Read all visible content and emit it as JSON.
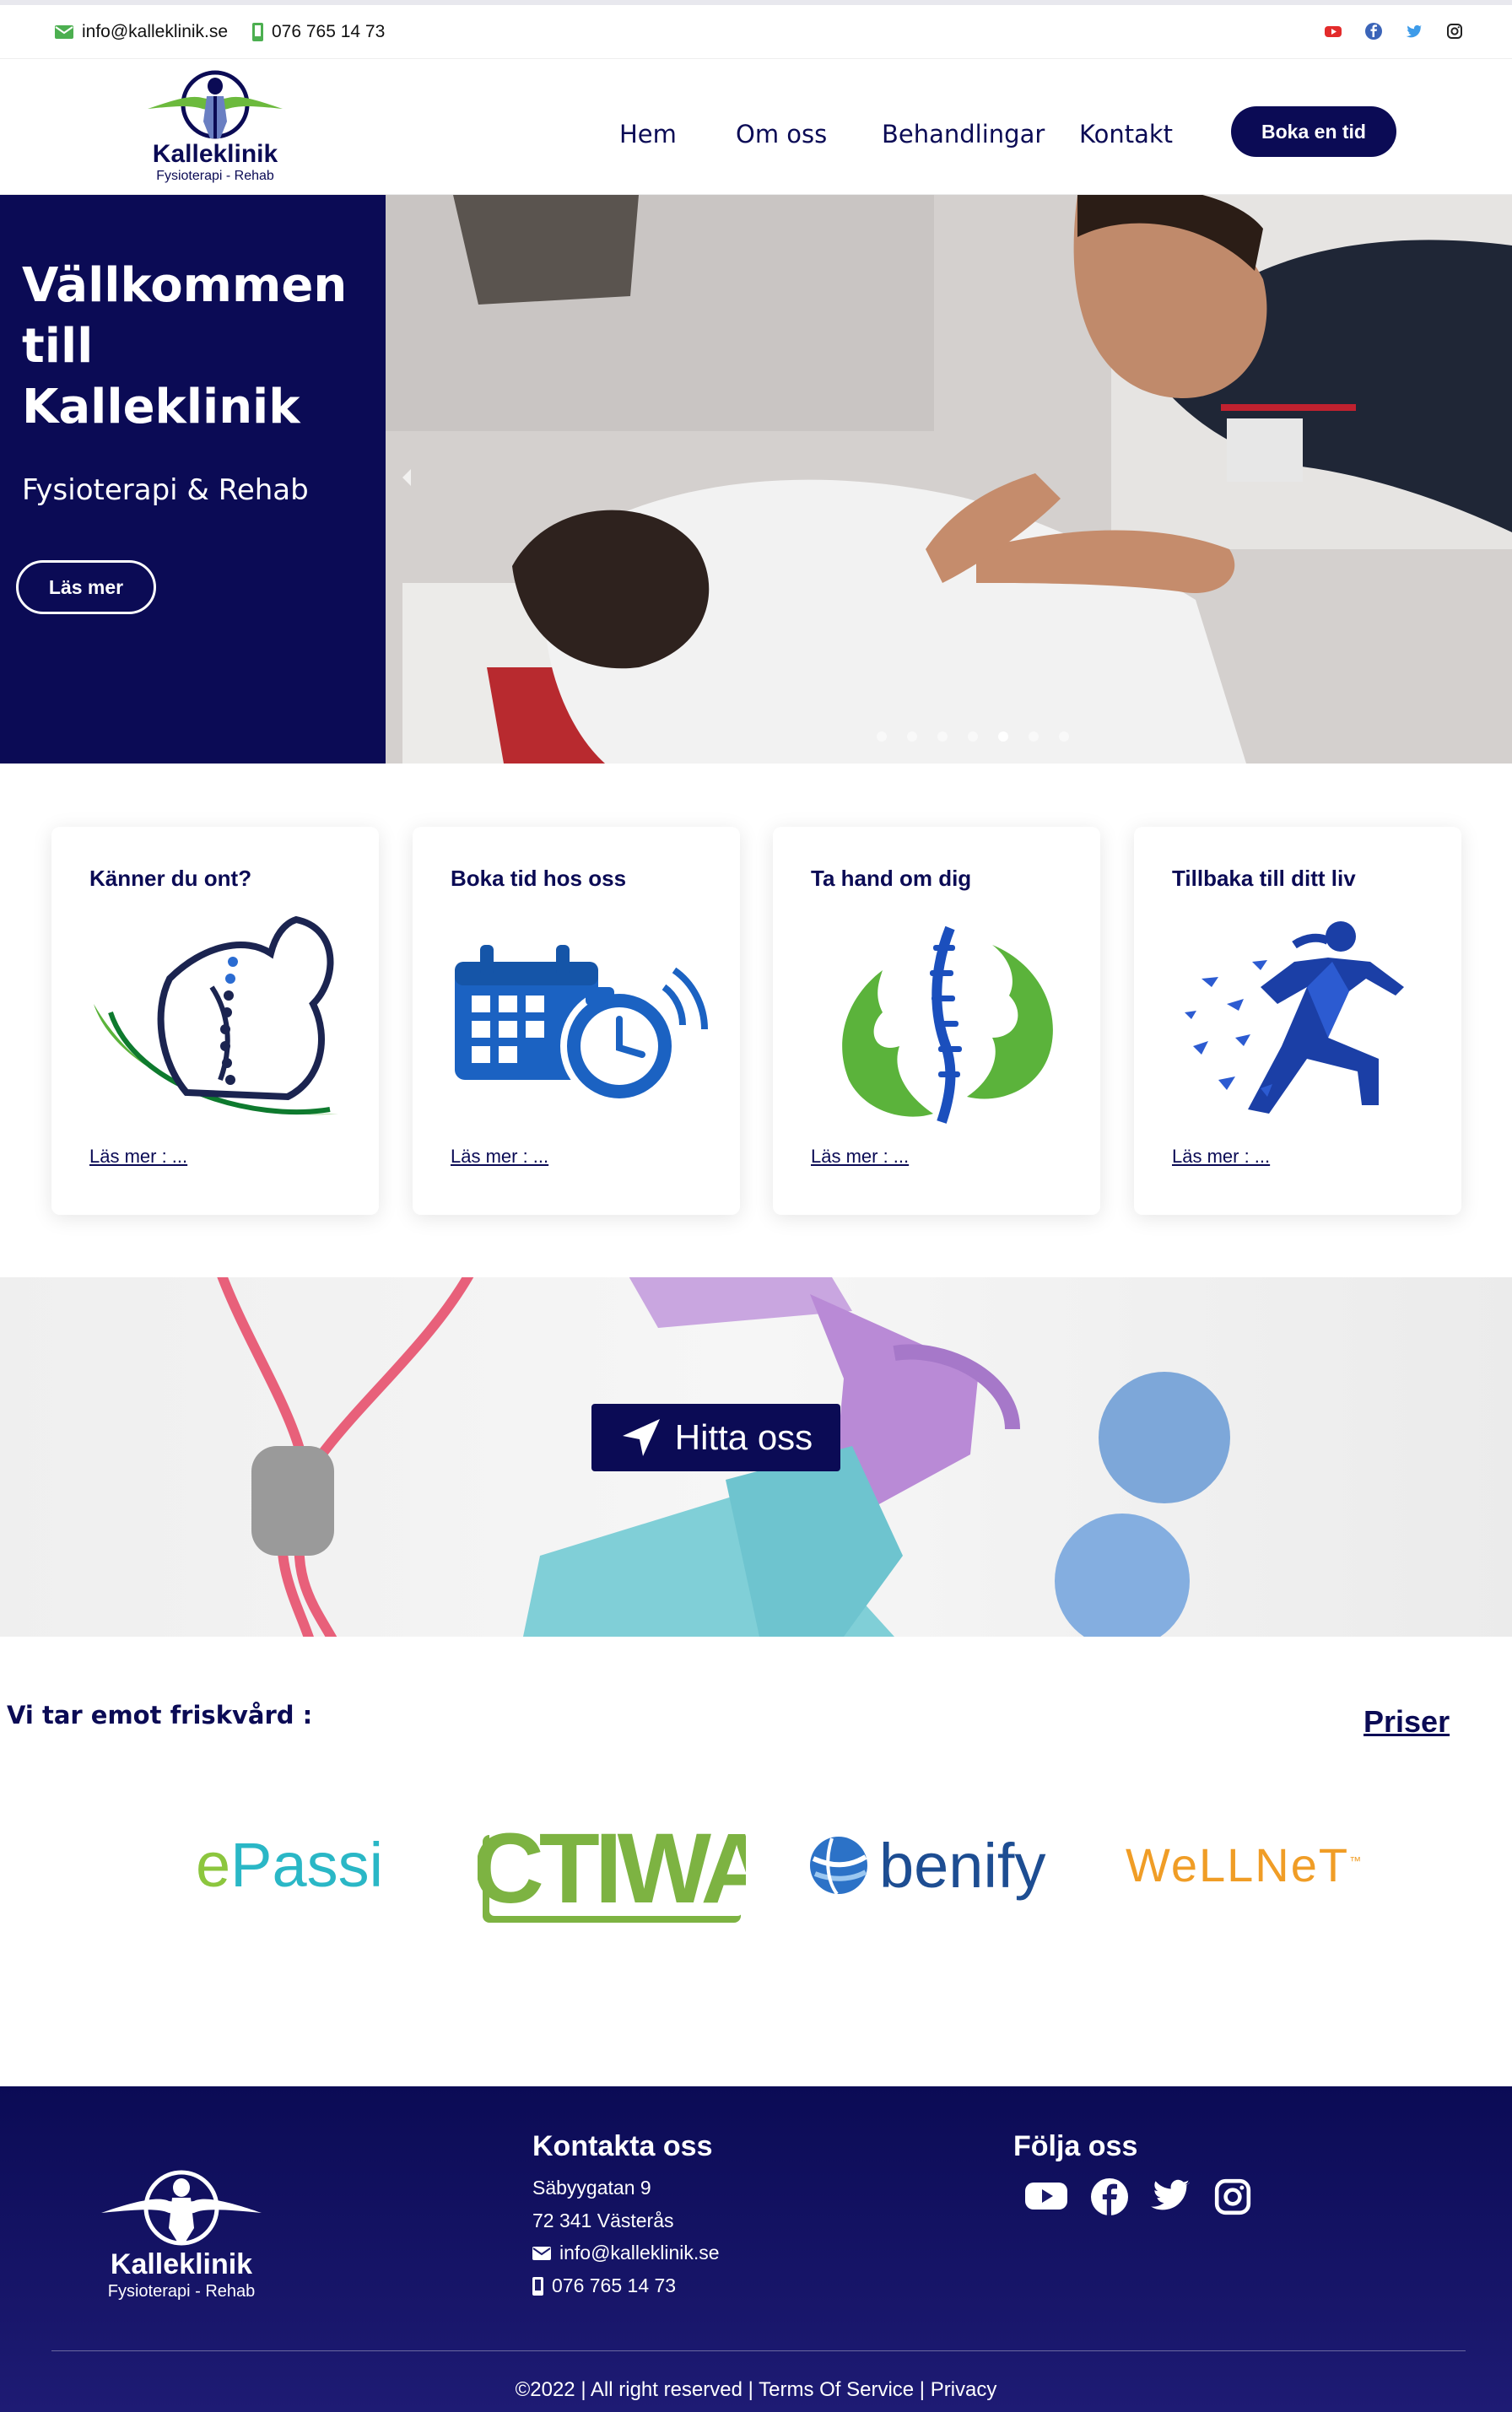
{
  "topbar": {
    "email": "info@kalleklinik.se",
    "phone": "076 765 14 73",
    "social_icons": [
      "youtube-icon",
      "facebook-icon",
      "twitter-icon",
      "instagram-icon"
    ]
  },
  "header": {
    "logo_name": "Kalleklinik",
    "logo_tagline": "Fysioterapi - Rehab",
    "nav": [
      "Hem",
      "Om oss",
      "Behandlingar",
      "Kontakt"
    ],
    "cta": "Boka en tid"
  },
  "hero": {
    "title": "Vällkommen till Kalleklinik",
    "subtitle": "Fysioterapi & Rehab",
    "button": "Läs mer",
    "slide_count": 7,
    "active_slide": 5
  },
  "cards": [
    {
      "title": "Känner du ont?",
      "link": "Läs mer : ..."
    },
    {
      "title": "Boka tid hos oss",
      "link": "Läs mer : ..."
    },
    {
      "title": "Ta hand om dig",
      "link": "Läs mer : ..."
    },
    {
      "title": "Tillbaka till ditt liv",
      "link": "Läs mer : ..."
    }
  ],
  "banner": {
    "button": "Hitta oss"
  },
  "partners": {
    "title": "Vi tar emot friskvård :",
    "prices_link": "Priser",
    "logos": [
      "ePassi",
      "ACTIWAY",
      "benify",
      "WELLNET"
    ]
  },
  "footer": {
    "logo_name": "Kalleklinik",
    "logo_tagline": "Fysioterapi - Rehab",
    "contact_heading": "Kontakta oss",
    "street": "Säbyygatan 9",
    "city": "72 341 Västerås",
    "email": "info@kalleklinik.se",
    "phone": "076 765 14 73",
    "follow_heading": "Följa oss",
    "copyright_text": "©2022 | All right reserved | ",
    "terms": "Terms Of Service",
    "privacy": "Privacy",
    "separator": " | "
  },
  "colors": {
    "navy": "#0b0b55",
    "green": "#4caf50",
    "accent_green": "#6cba3d"
  }
}
